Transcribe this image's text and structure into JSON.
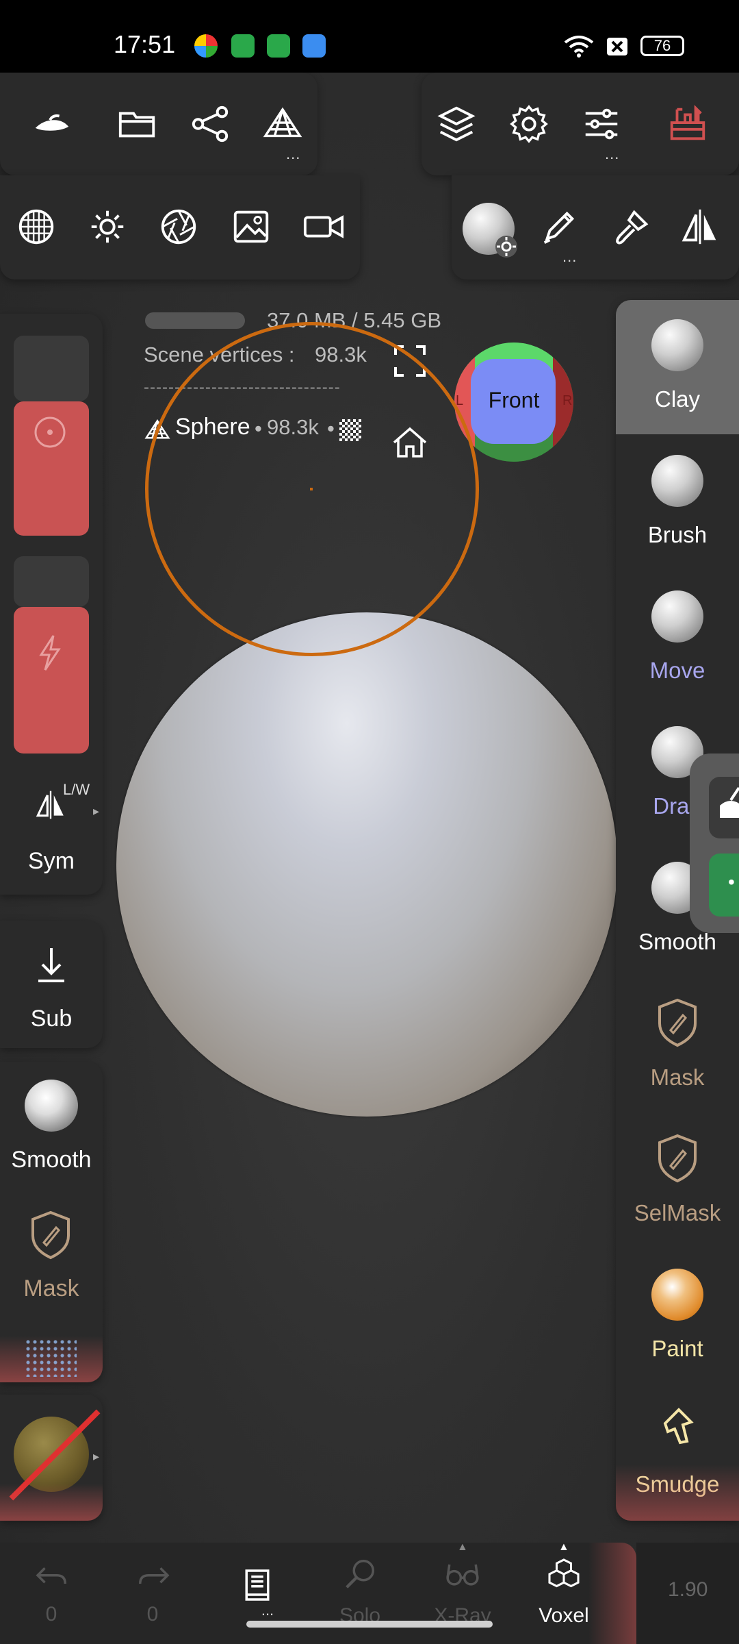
{
  "status_bar": {
    "time": "17:51",
    "battery": "76"
  },
  "top_toolbar": {
    "row1_left_more": "...",
    "row1_right_more": "...",
    "row2_right_more": "..."
  },
  "viewport_info": {
    "memory": "37.0 MB / 5.45 GB",
    "scene_vertices_label": "Scene vertices :",
    "scene_vertices_value": "98.3k",
    "separator": "--------------------------------",
    "object_name": "Sphere",
    "object_dot1": "•",
    "object_vertices": "98.3k",
    "object_dot2": "•"
  },
  "view_cube": {
    "label": "Front",
    "left_letter": "L",
    "right_letter": "R"
  },
  "left_panel": {
    "sym_hint": "L/W",
    "sym_label": "Sym",
    "sub_label": "Sub",
    "smooth_label": "Smooth",
    "mask_label": "Mask"
  },
  "brushes": [
    {
      "label": "Clay",
      "color": "#ffffff"
    },
    {
      "label": "Brush",
      "color": "#ffffff"
    },
    {
      "label": "Move",
      "color": "#a8a6ee"
    },
    {
      "label": "Drag",
      "color": "#a8a6ee"
    },
    {
      "label": "Smooth",
      "color": "#ffffff"
    },
    {
      "label": "Mask",
      "color": "#b99e82"
    },
    {
      "label": "SelMask",
      "color": "#b99e82"
    },
    {
      "label": "Paint",
      "color": "#f5e6a8"
    },
    {
      "label": "Smudge",
      "color": "#f5e6a8"
    }
  ],
  "bottom_bar": {
    "undo_count": "0",
    "redo_count": "0",
    "wire_more": "...",
    "solo_label": "Solo",
    "xray_label": "X-Ray",
    "voxel_label": "Voxel",
    "value": "1.90"
  },
  "colors": {
    "accent_red": "#c95353",
    "cursor_orange": "#cc6a10",
    "panel_bg": "#2a2a2a",
    "selected_brush_bg": "#6a6a6a"
  }
}
